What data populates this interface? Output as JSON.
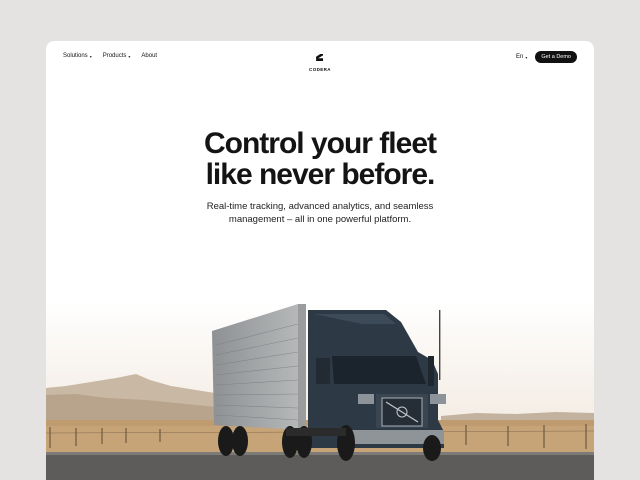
{
  "nav": {
    "items": [
      {
        "label": "Solutions",
        "has_dropdown": true
      },
      {
        "label": "Products",
        "has_dropdown": true
      },
      {
        "label": "About",
        "has_dropdown": false
      }
    ],
    "brand": "CODERA",
    "language": "En",
    "cta": "Get a Demo"
  },
  "hero": {
    "title_line1": "Control your fleet",
    "title_line2": "like never before.",
    "subtitle_line1": "Real-time tracking, advanced analytics, and seamless",
    "subtitle_line2": "management – all in one powerful platform."
  },
  "image": {
    "subject": "semi-truck-on-road",
    "colors": {
      "sky": "#f3ede6",
      "hills": "#bfae98",
      "field": "#c9a67a",
      "road": "#5b5a58",
      "cab": "#2c3642",
      "trailer": "#a4a7a9"
    }
  }
}
